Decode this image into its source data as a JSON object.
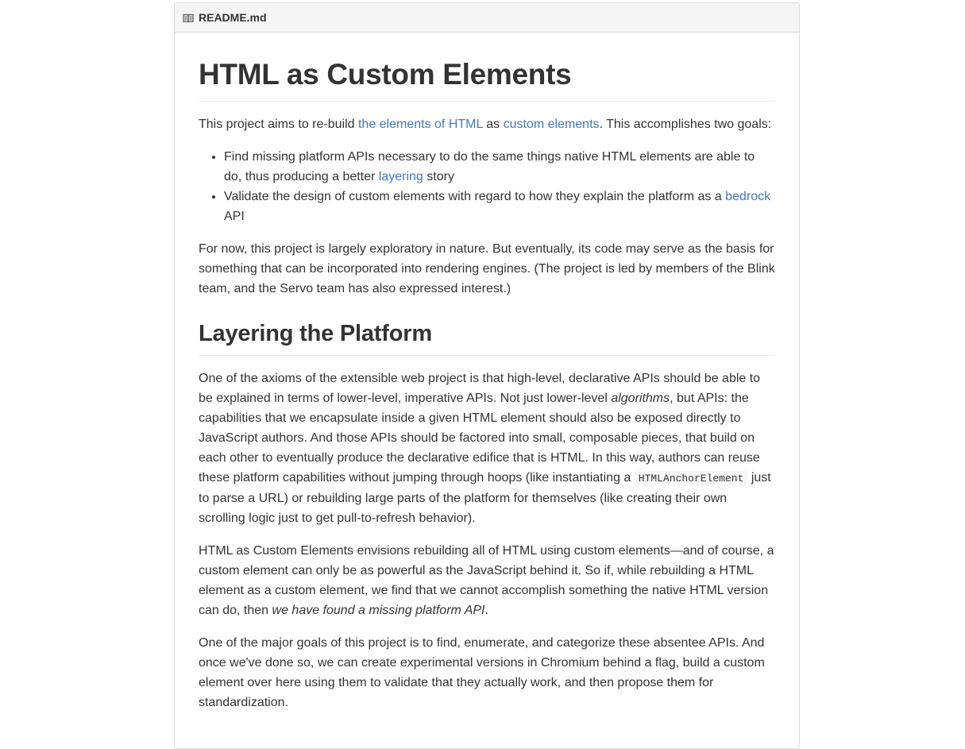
{
  "header": {
    "icon": "book-icon",
    "title": "README.md"
  },
  "title": "HTML as Custom Elements",
  "intro": {
    "t1": "This project aims to re-build ",
    "link1": "the elements of HTML",
    "t2": " as ",
    "link2": "custom elements",
    "t3": ". This accomplishes two goals:"
  },
  "goals": [
    {
      "t1": "Find missing platform APIs necessary to do the same things native HTML elements are able to do, thus producing a better ",
      "link": "layering",
      "t2": " story"
    },
    {
      "t1": "Validate the design of custom elements with regard to how they explain the platform as a ",
      "link": "bedrock",
      "t2": " API"
    }
  ],
  "p_exploratory": "For now, this project is largely exploratory in nature. But eventually, its code may serve as the basis for something that can be incorporated into rendering engines. (The project is led by members of the Blink team, and the Servo team has also expressed interest.)",
  "section2": {
    "heading": "Layering the Platform",
    "p1": {
      "t1": "One of the axioms of the extensible web project is that high-level, declarative APIs should be able to be explained in terms of lower-level, imperative APIs. Not just lower-level ",
      "em": "algorithms",
      "t2": ", but APIs: the capabilities that we encapsulate inside a given HTML element should also be exposed directly to JavaScript authors. And those APIs should be factored into small, composable pieces, that build on each other to eventually produce the declarative edifice that is HTML. In this way, authors can reuse these platform capabilities without jumping through hoops (like instantiating a ",
      "code": "HTMLAnchorElement",
      "t3": " just to parse a URL) or rebuilding large parts of the platform for themselves (like creating their own scrolling logic just to get pull-to-refresh behavior)."
    },
    "p2": {
      "t1": "HTML as Custom Elements envisions rebuilding all of HTML using custom elements—and of course, a custom element can only be as powerful as the JavaScript behind it. So if, while rebuilding a HTML element as a custom element, we find that we cannot accomplish something the native HTML version can do, then ",
      "em": "we have found a missing platform API",
      "t2": "."
    },
    "p3": "One of the major goals of this project is to find, enumerate, and categorize these absentee APIs. And once we've done so, we can create experimental versions in Chromium behind a flag, build a custom element over here using them to validate that they actually work, and then propose them for standardization."
  }
}
